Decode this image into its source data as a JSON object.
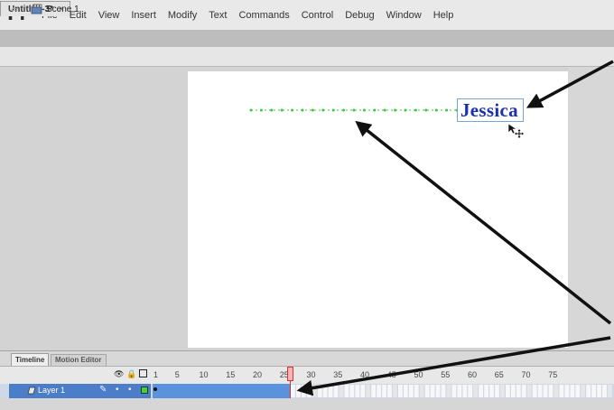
{
  "app": {
    "logo": "Fl"
  },
  "menu": [
    "File",
    "Edit",
    "View",
    "Insert",
    "Modify",
    "Text",
    "Commands",
    "Control",
    "Debug",
    "Window",
    "Help"
  ],
  "document_tab": {
    "label": "Untitled-3*",
    "close": "×"
  },
  "edit_bar": {
    "scene_label": "Scene 1"
  },
  "stage": {
    "text": "Jessica",
    "text_color": "#1b2fb5",
    "motion_path_color": "#3cc83c"
  },
  "timeline": {
    "tabs": [
      "Timeline",
      "Motion Editor"
    ],
    "frame_numbers": [
      "1",
      "5",
      "10",
      "15",
      "20",
      "25",
      "30",
      "35",
      "40",
      "45",
      "50",
      "55",
      "60",
      "65",
      "70",
      "75"
    ],
    "current_frame": 24,
    "layers": [
      {
        "name": "Layer 1"
      }
    ]
  },
  "colors": {
    "layer_selected": "#4b7dc8",
    "tween_span": "#5b92dd",
    "playhead": "#d63434",
    "annotation_arrow": "#111111"
  }
}
